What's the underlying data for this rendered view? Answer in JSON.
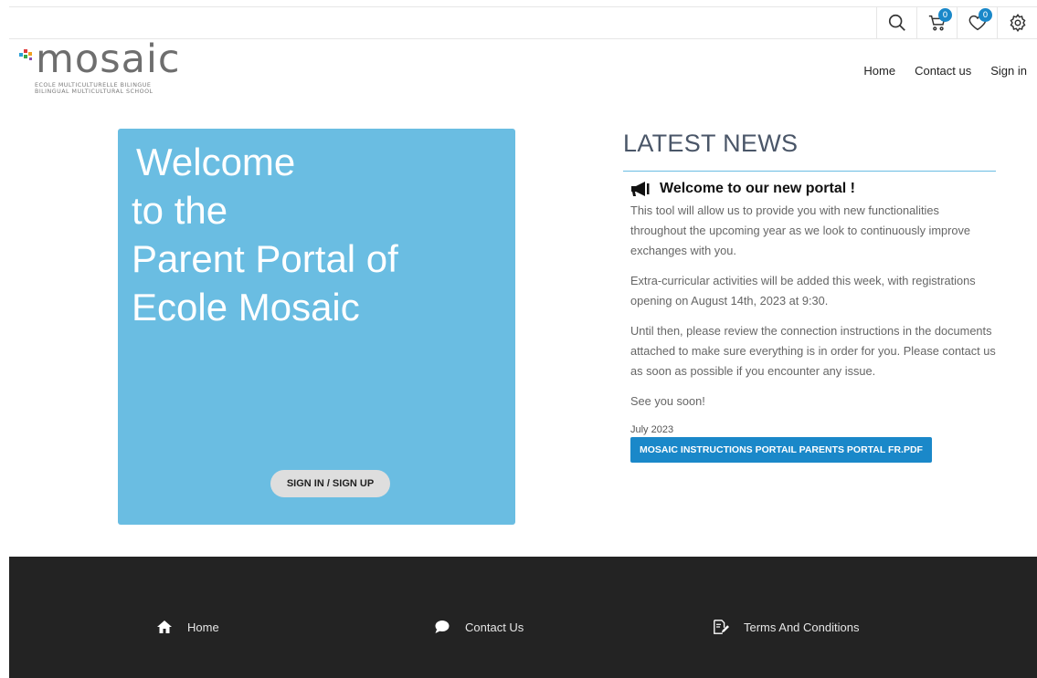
{
  "topbar": {
    "cart_count": "0",
    "wishlist_count": "0",
    "icons": [
      "search-icon",
      "cart-icon",
      "heart-icon",
      "gear-icon"
    ]
  },
  "logo": {
    "word": "mosaic",
    "line1": "ECOLE MULTICULTURELLE BILINGUE",
    "line2": "BILINGUAL MULTICULTURAL SCHOOL"
  },
  "nav": {
    "home": "Home",
    "contact": "Contact us",
    "signin": "Sign in"
  },
  "welcome": {
    "line1": "Welcome",
    "line2": "to the",
    "line3": "Parent Portal of",
    "line4": "Ecole Mosaic",
    "button": "SIGN IN / SIGN UP"
  },
  "news": {
    "title": "LATEST NEWS",
    "headline": "Welcome to our new portal !",
    "p1": "This tool will allow us to provide you with new functionalities throughout the upcoming year as we look to continuously improve exchanges with you.",
    "p2": "Extra-curricular activities will be added this week, with registrations opening on August 14th, 2023 at 9:30.",
    "p3": "Until then, please review the connection instructions in the documents attached to make sure everything is in order for you. Please contact us as soon as possible if you encounter any issue.",
    "p4": "See you soon!",
    "date": "July 2023",
    "attachment": "MOSAIC INSTRUCTIONS PORTAIL PARENTS PORTAL FR.PDF"
  },
  "footer": {
    "home": "Home",
    "contact": "Contact Us",
    "terms": "Terms And Conditions"
  },
  "colors": {
    "accent": "#6abde2",
    "button_blue": "#1a88c9",
    "footer_bg": "#232323"
  }
}
